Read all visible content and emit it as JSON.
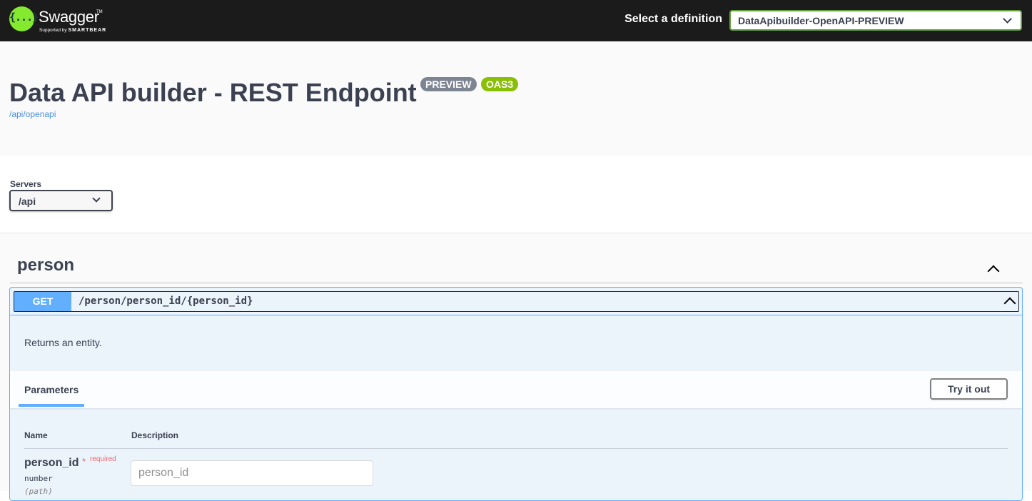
{
  "topbar": {
    "logo_glyph": "{...}",
    "logo_text": "Swagger",
    "logo_tm": "TM",
    "logo_supported": "Supported by",
    "logo_brand": "SMARTBEAR",
    "definition_label": "Select a definition",
    "definition_value": "DataApibuilder-OpenAPI-PREVIEW"
  },
  "info": {
    "title": "Data API builder - REST Endpoint",
    "badge_preview": "PREVIEW",
    "badge_oas": "OAS3",
    "url": "/api/openapi"
  },
  "servers": {
    "label": "Servers",
    "selected": "/api"
  },
  "tag": {
    "name": "person",
    "operation": {
      "method": "GET",
      "path": "/person/person_id/{person_id}",
      "description": "Returns an entity.",
      "parameters_tab": "Parameters",
      "try_button": "Try it out",
      "columns": {
        "name": "Name",
        "description": "Description"
      },
      "parameter": {
        "name": "person_id",
        "star": "*",
        "required": "required",
        "type": "number",
        "in": "(path)",
        "placeholder": "person_id"
      }
    }
  },
  "colors": {
    "topbar_bg": "#1b1b1b",
    "logo_green": "#85ea2d",
    "get_blue": "#61affe",
    "badge_preview": "#7d8492",
    "badge_oas": "#89bf04",
    "link": "#4990e2"
  }
}
